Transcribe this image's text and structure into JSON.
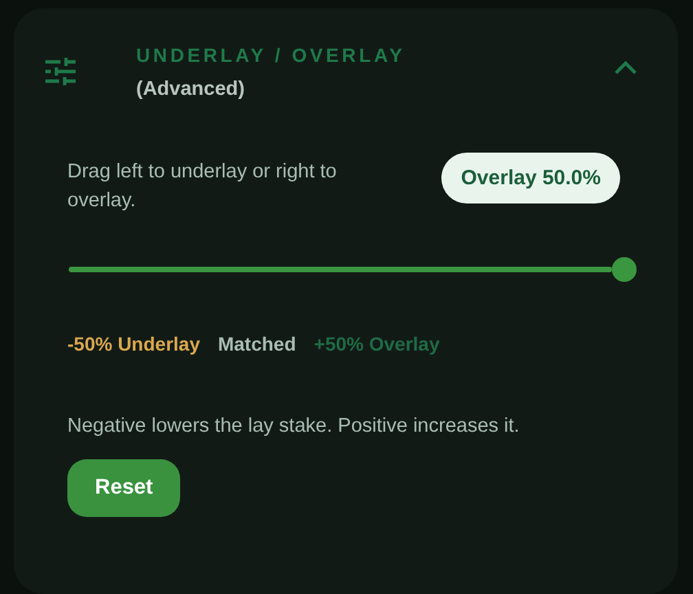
{
  "panel": {
    "title": "UNDERLAY / OVERLAY",
    "subtitle": "(Advanced)",
    "expanded": true
  },
  "description": "Drag left to underlay or right to overlay.",
  "value_badge": "Overlay 50.0%",
  "slider": {
    "level": 1.0
  },
  "legend": [
    {
      "label": "-50% Underlay",
      "color": "#d9a84e"
    },
    {
      "label": "Matched",
      "color": "#a9bdb2"
    },
    {
      "label": "+50% Overlay",
      "color": "#1f6b45"
    }
  ],
  "note": "Negative lowers the lay stake. Positive increases it.",
  "buttons": [
    "Reset"
  ]
}
